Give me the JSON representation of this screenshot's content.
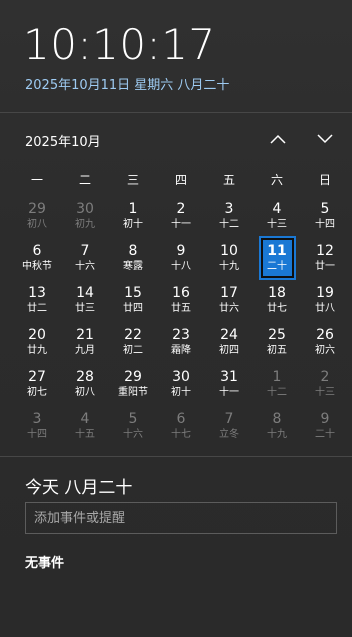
{
  "header": {
    "time": "10:10:17",
    "date_link": "2025年10月11日 星期六 八月二十"
  },
  "calendar": {
    "month_title": "2025年10月",
    "weekdays": [
      "一",
      "二",
      "三",
      "四",
      "五",
      "六",
      "日"
    ],
    "weeks": [
      [
        {
          "d": "29",
          "l": "初八",
          "o": true
        },
        {
          "d": "30",
          "l": "初九",
          "o": true
        },
        {
          "d": "1",
          "l": "初十"
        },
        {
          "d": "2",
          "l": "十一"
        },
        {
          "d": "3",
          "l": "十二"
        },
        {
          "d": "4",
          "l": "十三"
        },
        {
          "d": "5",
          "l": "十四"
        }
      ],
      [
        {
          "d": "6",
          "l": "中秋节"
        },
        {
          "d": "7",
          "l": "十六"
        },
        {
          "d": "8",
          "l": "寒露"
        },
        {
          "d": "9",
          "l": "十八"
        },
        {
          "d": "10",
          "l": "十九"
        },
        {
          "d": "11",
          "l": "二十",
          "t": true
        },
        {
          "d": "12",
          "l": "廿一"
        }
      ],
      [
        {
          "d": "13",
          "l": "廿二"
        },
        {
          "d": "14",
          "l": "廿三"
        },
        {
          "d": "15",
          "l": "廿四"
        },
        {
          "d": "16",
          "l": "廿五"
        },
        {
          "d": "17",
          "l": "廿六"
        },
        {
          "d": "18",
          "l": "廿七"
        },
        {
          "d": "19",
          "l": "廿八"
        }
      ],
      [
        {
          "d": "20",
          "l": "廿九"
        },
        {
          "d": "21",
          "l": "九月"
        },
        {
          "d": "22",
          "l": "初二"
        },
        {
          "d": "23",
          "l": "霜降"
        },
        {
          "d": "24",
          "l": "初四"
        },
        {
          "d": "25",
          "l": "初五"
        },
        {
          "d": "26",
          "l": "初六"
        }
      ],
      [
        {
          "d": "27",
          "l": "初七"
        },
        {
          "d": "28",
          "l": "初八"
        },
        {
          "d": "29",
          "l": "重阳节"
        },
        {
          "d": "30",
          "l": "初十"
        },
        {
          "d": "31",
          "l": "十一"
        },
        {
          "d": "1",
          "l": "十二",
          "o": true
        },
        {
          "d": "2",
          "l": "十三",
          "o": true
        }
      ],
      [
        {
          "d": "3",
          "l": "十四",
          "o": true
        },
        {
          "d": "4",
          "l": "十五",
          "o": true
        },
        {
          "d": "5",
          "l": "十六",
          "o": true
        },
        {
          "d": "6",
          "l": "十七",
          "o": true
        },
        {
          "d": "7",
          "l": "立冬",
          "o": true
        },
        {
          "d": "8",
          "l": "十九",
          "o": true
        },
        {
          "d": "9",
          "l": "二十",
          "o": true
        }
      ]
    ]
  },
  "agenda": {
    "title": "今天 八月二十",
    "input_placeholder": "添加事件或提醒",
    "empty_text": "无事件"
  },
  "icons": {
    "prev": "chevron-up-icon",
    "next": "chevron-down-icon"
  },
  "colors": {
    "accent": "#1a78d4",
    "link": "#9ecbf2",
    "background": "#2b2b2b"
  }
}
